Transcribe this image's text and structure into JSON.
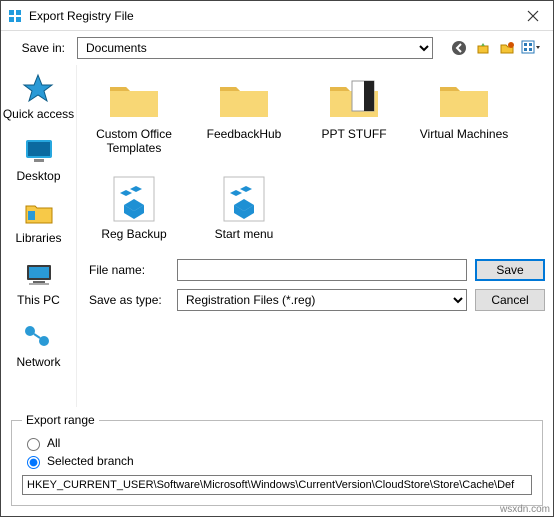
{
  "window": {
    "title": "Export Registry File"
  },
  "savein": {
    "label": "Save in:",
    "value": "Documents"
  },
  "places": [
    {
      "id": "quickaccess",
      "label": "Quick access"
    },
    {
      "id": "desktop",
      "label": "Desktop"
    },
    {
      "id": "libraries",
      "label": "Libraries"
    },
    {
      "id": "thispc",
      "label": "This PC"
    },
    {
      "id": "network",
      "label": "Network"
    }
  ],
  "items": [
    {
      "type": "folder",
      "label": "Custom Office Templates"
    },
    {
      "type": "folder",
      "label": "FeedbackHub"
    },
    {
      "type": "pptfolder",
      "label": "PPT STUFF"
    },
    {
      "type": "folder",
      "label": "Virtual Machines"
    },
    {
      "type": "reg",
      "label": "Reg Backup"
    },
    {
      "type": "reg",
      "label": "Start menu"
    }
  ],
  "fields": {
    "filename_label": "File name:",
    "filename_value": "",
    "saveastype_label": "Save as type:",
    "saveastype_value": "Registration Files (*.reg)"
  },
  "buttons": {
    "save": "Save",
    "cancel": "Cancel"
  },
  "export": {
    "legend": "Export range",
    "all": "All",
    "selected": "Selected branch",
    "branch_value": "HKEY_CURRENT_USER\\Software\\Microsoft\\Windows\\CurrentVersion\\CloudStore\\Store\\Cache\\Def"
  },
  "watermark": "wsxdn.com"
}
